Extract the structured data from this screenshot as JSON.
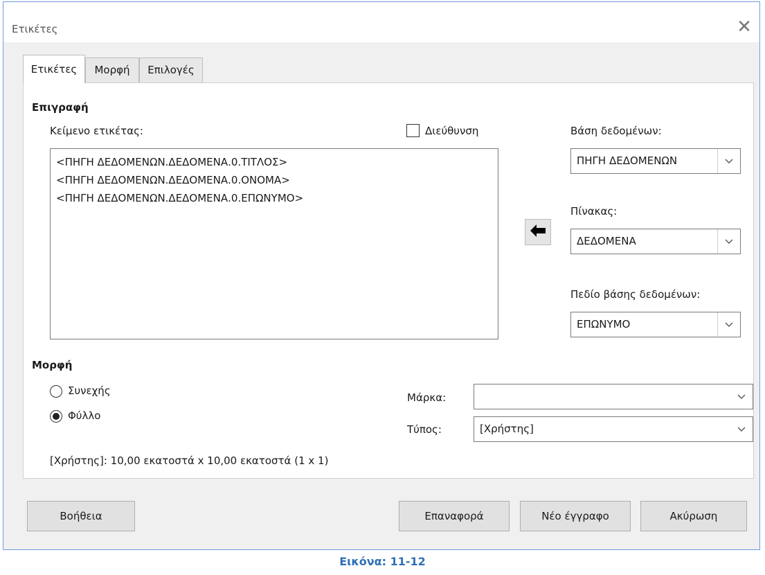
{
  "window": {
    "title": "Ετικέτες",
    "close_glyph": "✕"
  },
  "tabs": [
    {
      "label": "Ετικέτες",
      "active": true
    },
    {
      "label": "Μορφή",
      "active": false
    },
    {
      "label": "Επιλογές",
      "active": false
    }
  ],
  "inscription": {
    "heading": "Επιγραφή",
    "label_text_label": "Κείμενο ετικέτας:",
    "address_label": "Διεύθυνση",
    "address_checked": false,
    "lines": [
      "<ΠΗΓΗ ΔΕΔΟΜΕΝΩΝ.ΔΕΔΟΜΕΝΑ.0.ΤΙΤΛΟΣ>",
      "<ΠΗΓΗ ΔΕΔΟΜΕΝΩΝ.ΔΕΔΟΜΕΝΑ.0.ΟΝΟΜΑ>",
      "<ΠΗΓΗ ΔΕΔΟΜΕΝΩΝ.ΔΕΔΟΜΕΝΑ.0.ΕΠΩΝΥΜΟ>"
    ]
  },
  "database": {
    "db_label": "Βάση δεδομένων:",
    "db_value": "ΠΗΓΗ ΔΕΔΟΜΕΝΩΝ",
    "table_label": "Πίνακας:",
    "table_value": "ΔΕΔΟΜΕΝΑ",
    "field_label": "Πεδίο βάσης δεδομένων:",
    "field_value": "ΕΠΩΝΥΜΟ",
    "insert_icon": "left-arrow-icon"
  },
  "format": {
    "heading": "Μορφή",
    "continuous_label": "Συνεχής",
    "sheet_label": "Φύλλο",
    "selected": "sheet",
    "brand_label": "Μάρκα:",
    "brand_value": "",
    "type_label": "Τύπος:",
    "type_value": "[Χρήστης]",
    "summary": "[Χρήστης]: 10,00 εκατοστά x 10,00 εκατοστά (1 x 1)"
  },
  "buttons": {
    "help": "Βοήθεια",
    "reset": "Επαναφορά",
    "new_document": "Νέο έγγραφο",
    "cancel": "Ακύρωση"
  },
  "caption": "Εικόνα: 11-12",
  "colors": {
    "caption": "#2f6fb5",
    "border_accent": "#6d9be0"
  }
}
